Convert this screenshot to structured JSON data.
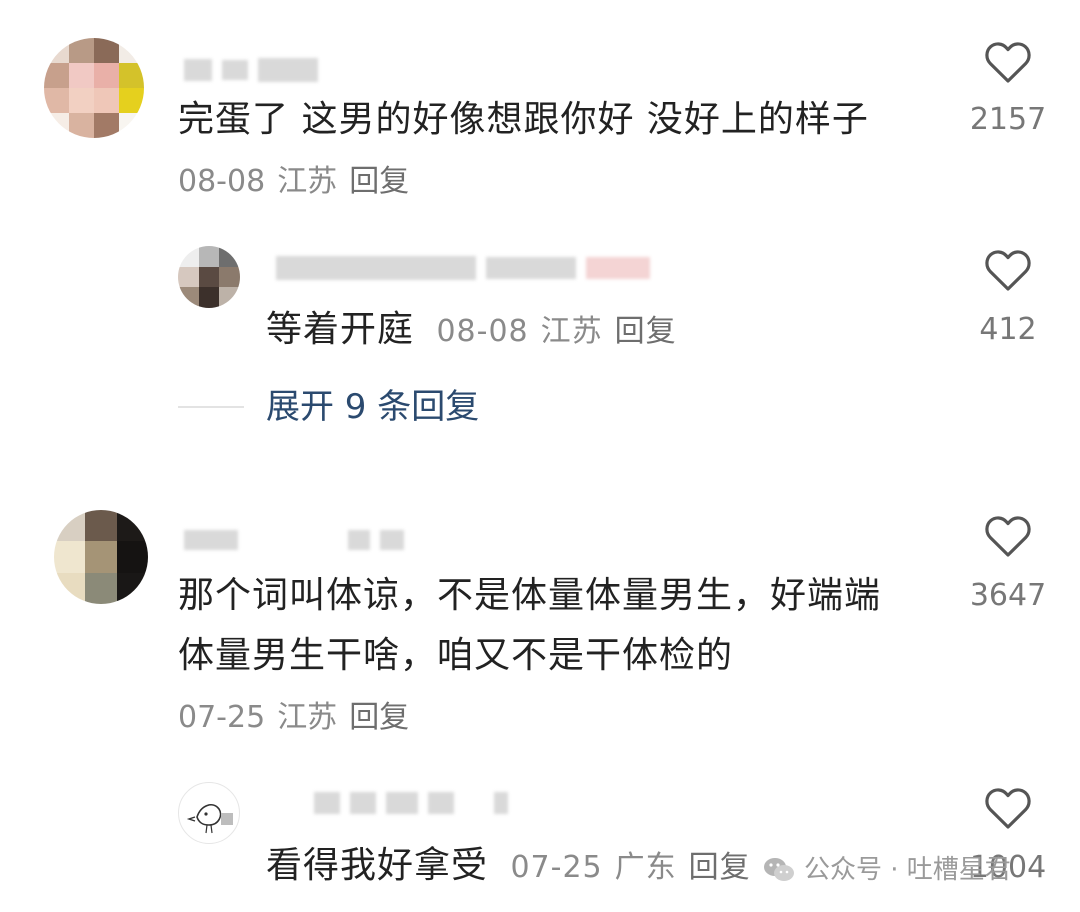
{
  "comments": [
    {
      "text": "完蛋了 这男的好像想跟你好 没好上的样子",
      "date": "08-08",
      "location": "江苏",
      "reply_label": "回复",
      "likes": "2157",
      "sub_reply": {
        "text": "等着开庭",
        "date": "08-08",
        "location": "江苏",
        "reply_label": "回复",
        "likes": "412"
      },
      "expand_label": "展开 9 条回复"
    },
    {
      "text_lines": [
        "那个词叫体谅，不是体量体量男生，好端端",
        "体量男生干啥，咱又不是干体检的"
      ],
      "date": "07-25",
      "location": "江苏",
      "reply_label": "回复",
      "likes": "3647",
      "sub_reply": {
        "text": "看得我好拿受",
        "date": "07-25",
        "location": "广东",
        "reply_label": "回复",
        "likes": "1004"
      }
    }
  ],
  "watermark": {
    "icon": "wechat-icon",
    "text": "公众号 · 吐槽星君"
  },
  "colors": {
    "text": "#222222",
    "meta": "#8a8a8a",
    "link": "#2b4a6f",
    "like_outline": "#555555"
  }
}
